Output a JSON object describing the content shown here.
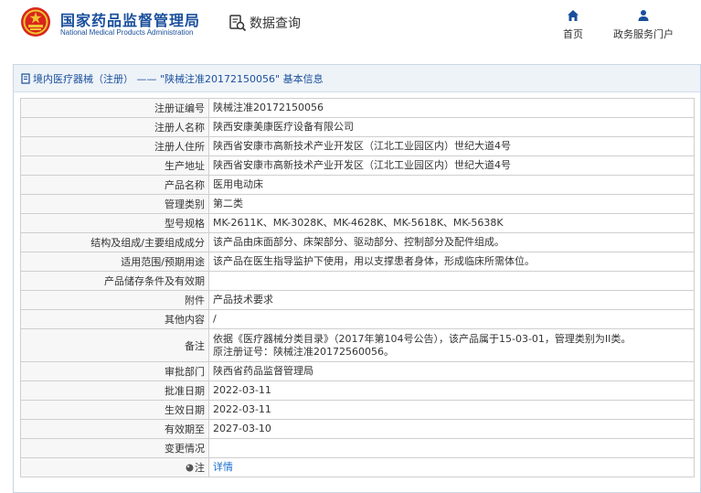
{
  "header": {
    "brand_cn": "国家药品监督管理局",
    "brand_en": "National Medical Products Administration",
    "search_label": "数据查询",
    "nav_home": "首页",
    "nav_user": "政务服务门户"
  },
  "breadcrumb": "境内医疗器械（注册） —— \"陕械注准20172150056\" 基本信息",
  "records": [
    {
      "label": "注册证编号",
      "value": "陕械注准20172150056"
    },
    {
      "label": "注册人名称",
      "value": "陕西安康美康医疗设备有限公司"
    },
    {
      "label": "注册人住所",
      "value": "陕西省安康市高新技术产业开发区（江北工业园区内）世纪大道4号"
    },
    {
      "label": "生产地址",
      "value": "陕西省安康市高新技术产业开发区（江北工业园区内）世纪大道4号"
    },
    {
      "label": "产品名称",
      "value": "医用电动床"
    },
    {
      "label": "管理类别",
      "value": "第二类"
    },
    {
      "label": "型号规格",
      "value": "MK-2611K、MK-3028K、MK-4628K、MK-5618K、MK-5638K"
    },
    {
      "label": "结构及组成/主要组成成分",
      "value": "该产品由床面部分、床架部分、驱动部分、控制部分及配件组成。"
    },
    {
      "label": "适用范围/预期用途",
      "value": "该产品在医生指导监护下使用，用以支撑患者身体，形成临床所需体位。"
    },
    {
      "label": "产品储存条件及有效期",
      "value": ""
    },
    {
      "label": "附件",
      "value": "产品技术要求"
    },
    {
      "label": "其他内容",
      "value": "/"
    },
    {
      "label": "备注",
      "value": "依据《医疗器械分类目录》（2017年第104号公告），该产品属于15-03-01，管理类别为II类。",
      "value2": "原注册证号：陕械注准20172560056。"
    },
    {
      "label": "审批部门",
      "value": "陕西省药品监督管理局"
    },
    {
      "label": "批准日期",
      "value": "2022-03-11"
    },
    {
      "label": "生效日期",
      "value": "2022-03-11"
    },
    {
      "label": "有效期至",
      "value": "2027-03-10"
    },
    {
      "label": "变更情况",
      "value": ""
    },
    {
      "label": "注",
      "value": "详情"
    }
  ],
  "colors": {
    "brand_blue": "#1a4f9c",
    "link_blue": "#1a6ed1",
    "emblem_red": "#d8261c",
    "emblem_gold": "#f1c232"
  },
  "icons": {
    "emblem": "national-emblem-icon",
    "search": "data-query-icon",
    "home": "home-icon",
    "user": "user-icon",
    "breadcrumb": "document-icon",
    "note": "note-icon"
  }
}
